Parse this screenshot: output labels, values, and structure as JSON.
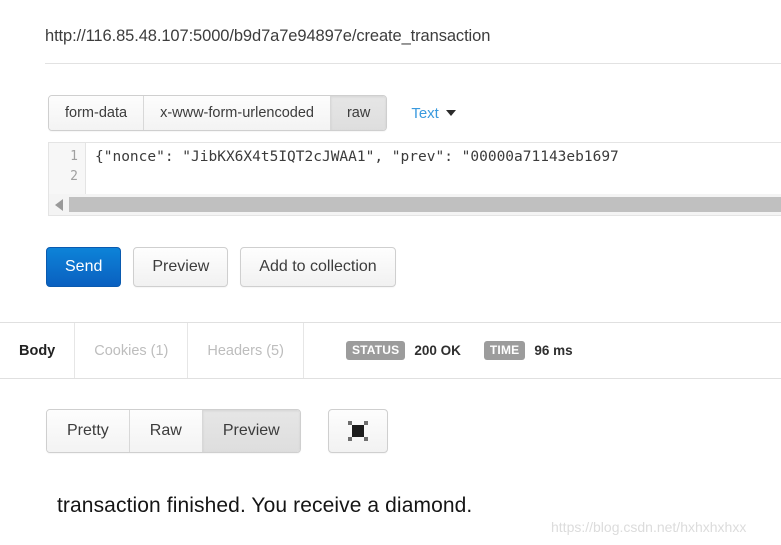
{
  "request": {
    "url": "http://116.85.48.107:5000/b9d7a7e94897e/create_transaction",
    "body_types": [
      {
        "label": "form-data",
        "active": false
      },
      {
        "label": "x-www-form-urlencoded",
        "active": false
      },
      {
        "label": "raw",
        "active": true
      }
    ],
    "format_select": {
      "label": "Text",
      "caret": "chevron-down-icon"
    },
    "editor": {
      "line_numbers": [
        "1",
        "2"
      ],
      "line1": "{\"nonce\": \"JibKX6X4t5IQT2cJWAA1\", \"prev\": \"00000a71143eb1697",
      "line2": ""
    },
    "actions": {
      "send": "Send",
      "preview": "Preview",
      "add_to_collection": "Add to collection"
    }
  },
  "response": {
    "tabs": [
      {
        "label": "Body",
        "active": true
      },
      {
        "label": "Cookies (1)",
        "active": false
      },
      {
        "label": "Headers (5)",
        "active": false
      }
    ],
    "meta": {
      "status_badge": "STATUS",
      "status_value": "200 OK",
      "time_badge": "TIME",
      "time_value": "96 ms"
    },
    "view_modes": [
      {
        "label": "Pretty",
        "active": false
      },
      {
        "label": "Raw",
        "active": false
      },
      {
        "label": "Preview",
        "active": true
      }
    ],
    "fullscreen_icon": "fullscreen-icon",
    "body_text": "transaction finished. You receive a diamond."
  },
  "watermark": "https://blog.csdn.net/hxhxhxhxx",
  "colors": {
    "primary_blue": "#0d83d8",
    "link_blue": "#3a9ade",
    "badge_gray": "#9c9c9c",
    "border_gray": "#e0e0e0"
  }
}
